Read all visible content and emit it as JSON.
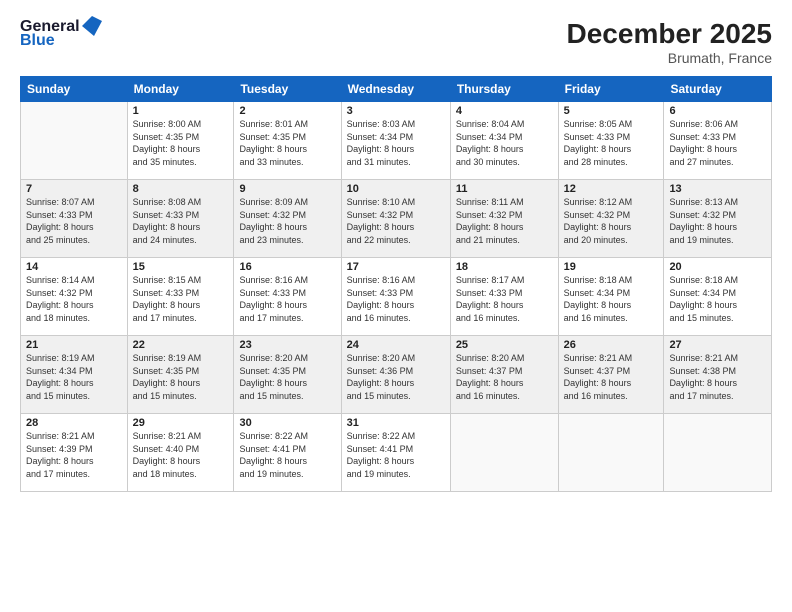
{
  "logo": {
    "line1": "General",
    "line2": "Blue"
  },
  "header": {
    "month_year": "December 2025",
    "location": "Brumath, France"
  },
  "days_of_week": [
    "Sunday",
    "Monday",
    "Tuesday",
    "Wednesday",
    "Thursday",
    "Friday",
    "Saturday"
  ],
  "weeks": [
    [
      {
        "num": "",
        "info": ""
      },
      {
        "num": "1",
        "info": "Sunrise: 8:00 AM\nSunset: 4:35 PM\nDaylight: 8 hours\nand 35 minutes."
      },
      {
        "num": "2",
        "info": "Sunrise: 8:01 AM\nSunset: 4:35 PM\nDaylight: 8 hours\nand 33 minutes."
      },
      {
        "num": "3",
        "info": "Sunrise: 8:03 AM\nSunset: 4:34 PM\nDaylight: 8 hours\nand 31 minutes."
      },
      {
        "num": "4",
        "info": "Sunrise: 8:04 AM\nSunset: 4:34 PM\nDaylight: 8 hours\nand 30 minutes."
      },
      {
        "num": "5",
        "info": "Sunrise: 8:05 AM\nSunset: 4:33 PM\nDaylight: 8 hours\nand 28 minutes."
      },
      {
        "num": "6",
        "info": "Sunrise: 8:06 AM\nSunset: 4:33 PM\nDaylight: 8 hours\nand 27 minutes."
      }
    ],
    [
      {
        "num": "7",
        "info": "Sunrise: 8:07 AM\nSunset: 4:33 PM\nDaylight: 8 hours\nand 25 minutes."
      },
      {
        "num": "8",
        "info": "Sunrise: 8:08 AM\nSunset: 4:33 PM\nDaylight: 8 hours\nand 24 minutes."
      },
      {
        "num": "9",
        "info": "Sunrise: 8:09 AM\nSunset: 4:32 PM\nDaylight: 8 hours\nand 23 minutes."
      },
      {
        "num": "10",
        "info": "Sunrise: 8:10 AM\nSunset: 4:32 PM\nDaylight: 8 hours\nand 22 minutes."
      },
      {
        "num": "11",
        "info": "Sunrise: 8:11 AM\nSunset: 4:32 PM\nDaylight: 8 hours\nand 21 minutes."
      },
      {
        "num": "12",
        "info": "Sunrise: 8:12 AM\nSunset: 4:32 PM\nDaylight: 8 hours\nand 20 minutes."
      },
      {
        "num": "13",
        "info": "Sunrise: 8:13 AM\nSunset: 4:32 PM\nDaylight: 8 hours\nand 19 minutes."
      }
    ],
    [
      {
        "num": "14",
        "info": "Sunrise: 8:14 AM\nSunset: 4:32 PM\nDaylight: 8 hours\nand 18 minutes."
      },
      {
        "num": "15",
        "info": "Sunrise: 8:15 AM\nSunset: 4:33 PM\nDaylight: 8 hours\nand 17 minutes."
      },
      {
        "num": "16",
        "info": "Sunrise: 8:16 AM\nSunset: 4:33 PM\nDaylight: 8 hours\nand 17 minutes."
      },
      {
        "num": "17",
        "info": "Sunrise: 8:16 AM\nSunset: 4:33 PM\nDaylight: 8 hours\nand 16 minutes."
      },
      {
        "num": "18",
        "info": "Sunrise: 8:17 AM\nSunset: 4:33 PM\nDaylight: 8 hours\nand 16 minutes."
      },
      {
        "num": "19",
        "info": "Sunrise: 8:18 AM\nSunset: 4:34 PM\nDaylight: 8 hours\nand 16 minutes."
      },
      {
        "num": "20",
        "info": "Sunrise: 8:18 AM\nSunset: 4:34 PM\nDaylight: 8 hours\nand 15 minutes."
      }
    ],
    [
      {
        "num": "21",
        "info": "Sunrise: 8:19 AM\nSunset: 4:34 PM\nDaylight: 8 hours\nand 15 minutes."
      },
      {
        "num": "22",
        "info": "Sunrise: 8:19 AM\nSunset: 4:35 PM\nDaylight: 8 hours\nand 15 minutes."
      },
      {
        "num": "23",
        "info": "Sunrise: 8:20 AM\nSunset: 4:35 PM\nDaylight: 8 hours\nand 15 minutes."
      },
      {
        "num": "24",
        "info": "Sunrise: 8:20 AM\nSunset: 4:36 PM\nDaylight: 8 hours\nand 15 minutes."
      },
      {
        "num": "25",
        "info": "Sunrise: 8:20 AM\nSunset: 4:37 PM\nDaylight: 8 hours\nand 16 minutes."
      },
      {
        "num": "26",
        "info": "Sunrise: 8:21 AM\nSunset: 4:37 PM\nDaylight: 8 hours\nand 16 minutes."
      },
      {
        "num": "27",
        "info": "Sunrise: 8:21 AM\nSunset: 4:38 PM\nDaylight: 8 hours\nand 17 minutes."
      }
    ],
    [
      {
        "num": "28",
        "info": "Sunrise: 8:21 AM\nSunset: 4:39 PM\nDaylight: 8 hours\nand 17 minutes."
      },
      {
        "num": "29",
        "info": "Sunrise: 8:21 AM\nSunset: 4:40 PM\nDaylight: 8 hours\nand 18 minutes."
      },
      {
        "num": "30",
        "info": "Sunrise: 8:22 AM\nSunset: 4:41 PM\nDaylight: 8 hours\nand 19 minutes."
      },
      {
        "num": "31",
        "info": "Sunrise: 8:22 AM\nSunset: 4:41 PM\nDaylight: 8 hours\nand 19 minutes."
      },
      {
        "num": "",
        "info": ""
      },
      {
        "num": "",
        "info": ""
      },
      {
        "num": "",
        "info": ""
      }
    ]
  ]
}
